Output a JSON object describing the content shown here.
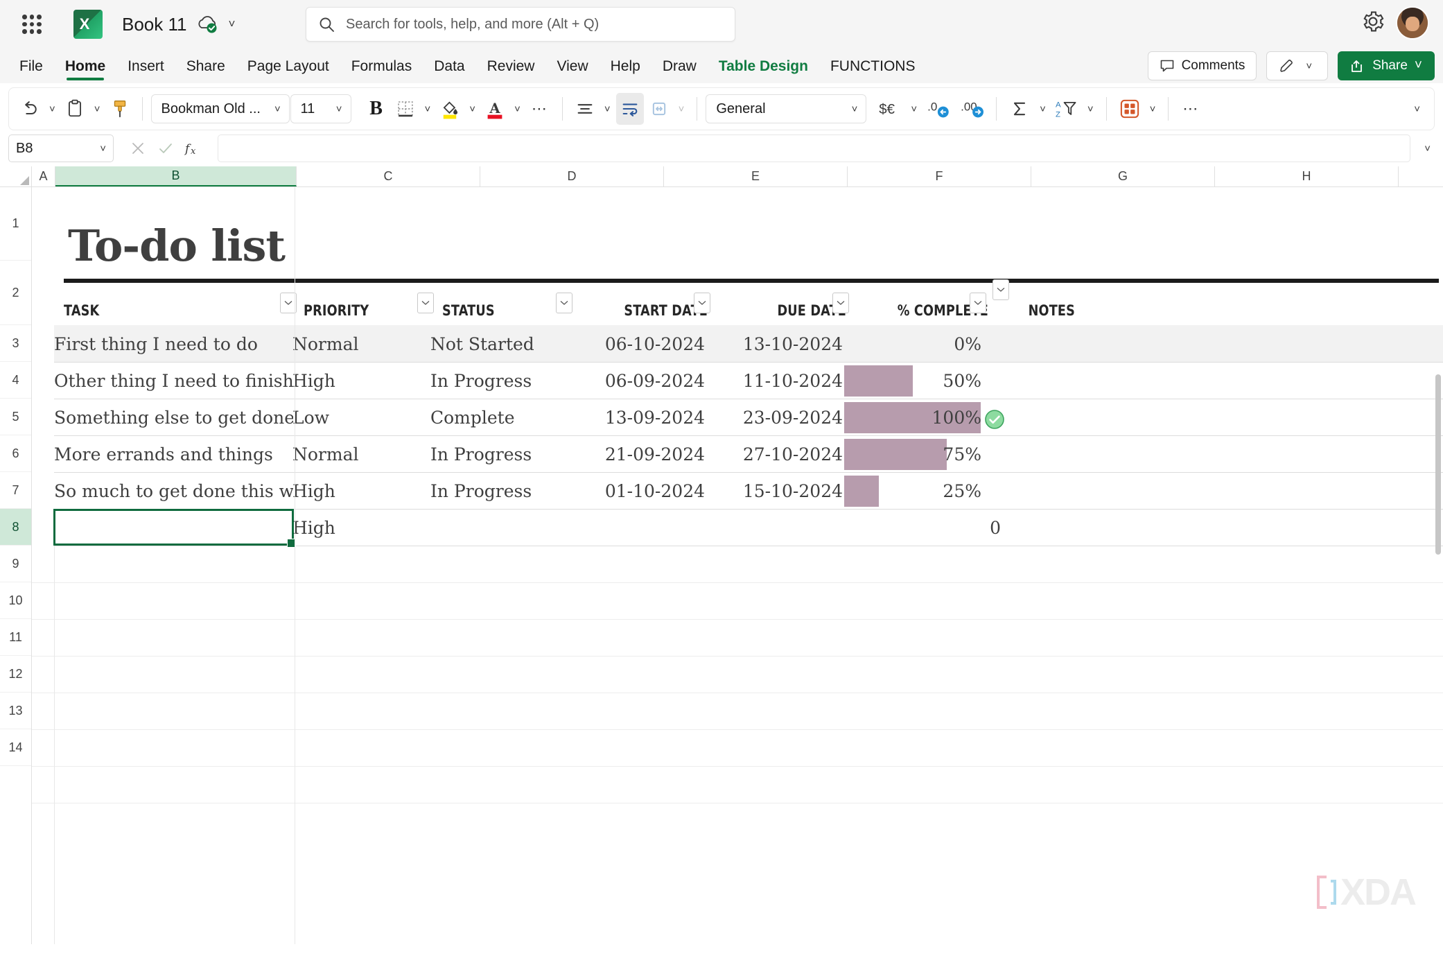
{
  "titlebar": {
    "app_icon": "excel-logo",
    "document_name": "Book 11",
    "autosave_icon": "cloud-saved-icon",
    "search_placeholder": "Search for tools, help, and more (Alt + Q)",
    "settings_icon": "gear-icon",
    "account_icon": "user-avatar"
  },
  "ribbon": {
    "tabs": [
      {
        "label": "File",
        "active": false,
        "style": "normal"
      },
      {
        "label": "Home",
        "active": true,
        "style": "normal"
      },
      {
        "label": "Insert",
        "active": false,
        "style": "normal"
      },
      {
        "label": "Share",
        "active": false,
        "style": "normal"
      },
      {
        "label": "Page Layout",
        "active": false,
        "style": "normal"
      },
      {
        "label": "Formulas",
        "active": false,
        "style": "normal"
      },
      {
        "label": "Data",
        "active": false,
        "style": "normal"
      },
      {
        "label": "Review",
        "active": false,
        "style": "normal"
      },
      {
        "label": "View",
        "active": false,
        "style": "normal"
      },
      {
        "label": "Help",
        "active": false,
        "style": "normal"
      },
      {
        "label": "Draw",
        "active": false,
        "style": "normal"
      },
      {
        "label": "Table Design",
        "active": false,
        "style": "green-bold"
      },
      {
        "label": "FUNCTIONS",
        "active": false,
        "style": "normal"
      }
    ],
    "comments_label": "Comments",
    "comments_icon": "comment-bubble-icon",
    "editing_icon": "pencil-icon",
    "share_label": "Share",
    "share_icon": "share-arrow-icon",
    "accent_green": "#107c41"
  },
  "toolbar": {
    "undo_icon": "undo-arrow-icon",
    "paste_icon": "clipboard-icon",
    "format_painter_icon": "paint-brush-icon",
    "font_name": "Bookman Old ...",
    "font_size": "11",
    "bold_label": "B",
    "borders_icon": "borders-icon",
    "fill_color_icon": "fill-color-icon",
    "font_color_icon": "font-color-icon",
    "more_font_icon": "ellipsis-icon",
    "align_icon": "align-icon",
    "wrap_text_icon": "wrap-text-icon",
    "merge_icon": "merge-cells-icon",
    "number_format": "General",
    "currency_icon": "currency-icon",
    "decrease_decimal_icon": "decrease-decimal-icon",
    "increase_decimal_icon": "increase-decimal-icon",
    "autosum_icon": "sigma-icon",
    "sort_filter_icon": "sort-filter-icon",
    "cells_icon": "cells-grid-icon",
    "more_icon": "ellipsis-icon",
    "collapse_icon": "chevron-down-icon"
  },
  "formula_bar": {
    "name_box_value": "B8",
    "cancel_icon": "x-icon",
    "enter_icon": "check-icon",
    "function_icon": "fx-icon",
    "formula_value": "",
    "expand_icon": "chevron-down-icon"
  },
  "grid": {
    "columns": [
      "A",
      "B",
      "C",
      "D",
      "E",
      "F",
      "G",
      "H"
    ],
    "selected_column": "B",
    "rows": [
      "1",
      "2",
      "3",
      "4",
      "5",
      "6",
      "7",
      "8",
      "9",
      "10",
      "11",
      "12",
      "13",
      "14"
    ],
    "selected_row": "8",
    "selected_cell": "B8"
  },
  "sheet": {
    "title": "To-do list",
    "table_headers": [
      "TASK",
      "PRIORITY",
      "STATUS",
      "START DATE",
      "DUE DATE",
      "% COMPLETE",
      "NOTES"
    ],
    "rows": [
      {
        "task": "First thing I need to do",
        "priority": "Normal",
        "status": "Not Started",
        "start": "06-10-2024",
        "due": "13-10-2024",
        "percent": "0%",
        "percent_value": 0,
        "notes": "",
        "complete": false
      },
      {
        "task": "Other thing I need to finish",
        "priority": "High",
        "status": "In Progress",
        "start": "06-09-2024",
        "due": "11-10-2024",
        "percent": "50%",
        "percent_value": 50,
        "notes": "",
        "complete": false
      },
      {
        "task": "Something else to get done",
        "priority": "Low",
        "status": "Complete",
        "start": "13-09-2024",
        "due": "23-09-2024",
        "percent": "100%",
        "percent_value": 100,
        "notes": "",
        "complete": true
      },
      {
        "task": "More errands and things",
        "priority": "Normal",
        "status": "In Progress",
        "start": "21-09-2024",
        "due": "27-10-2024",
        "percent": "75%",
        "percent_value": 75,
        "notes": "",
        "complete": false
      },
      {
        "task": "So much to get done this week",
        "priority": "High",
        "status": "In Progress",
        "start": "01-10-2024",
        "due": "15-10-2024",
        "percent": "25%",
        "percent_value": 25,
        "notes": "",
        "complete": false
      },
      {
        "task": "",
        "priority": "High",
        "status": "",
        "start": "",
        "due": "",
        "percent": "0",
        "percent_value": 0,
        "notes": "",
        "complete": false
      }
    ],
    "databar_color": "#b79cad",
    "banded_row_color": "#f2f2f2",
    "complete_icon": "green-check-circle-icon"
  },
  "watermark": {
    "text": "XDA"
  }
}
